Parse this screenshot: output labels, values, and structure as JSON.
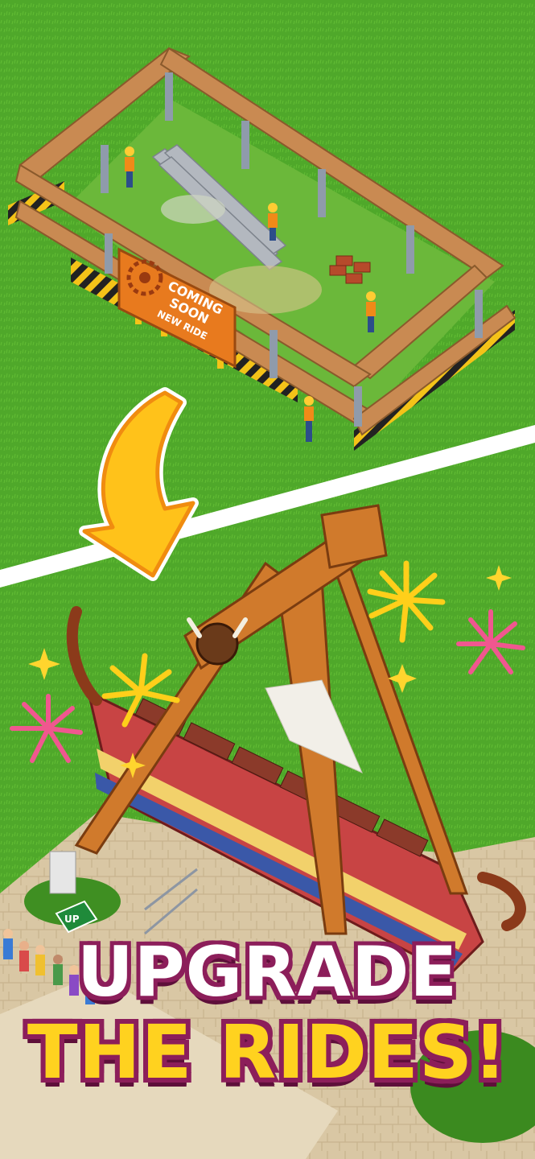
{
  "sign": {
    "line1": "COMING",
    "line2": "SOON",
    "line3": "NEW RIDE"
  },
  "marker": {
    "label": "UP"
  },
  "headline": {
    "line1": "UPGRADE",
    "line2": "THE RIDES!"
  },
  "colors": {
    "grass": "#4fa82a",
    "wood": "#c98a52",
    "sign": "#e87a1e",
    "arrow": "#ffc21a",
    "headline_outline": "#8c1e5a",
    "headline_accent": "#ffd21f"
  }
}
